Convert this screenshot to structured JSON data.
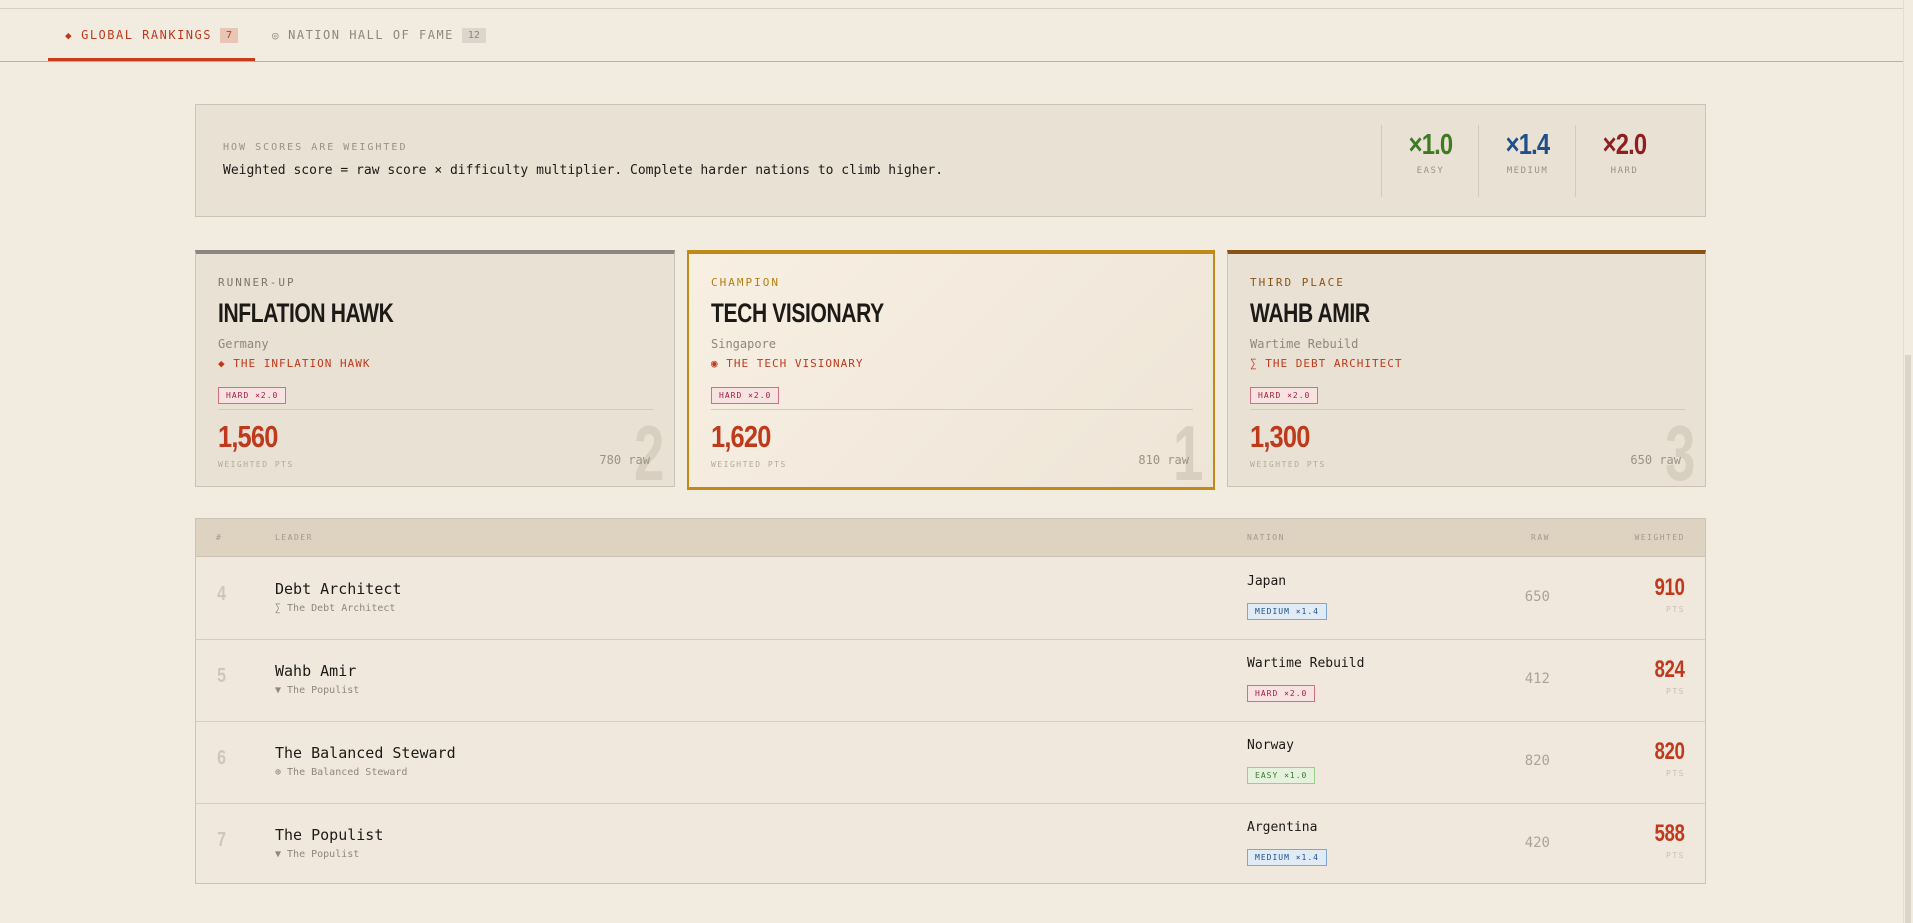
{
  "tabs": [
    {
      "glyph": "◆",
      "label": "GLOBAL RANKINGS",
      "count": "7"
    },
    {
      "glyph": "◎",
      "label": "NATION HALL OF FAME",
      "count": "12"
    }
  ],
  "weights": {
    "kicker": "HOW SCORES ARE WEIGHTED",
    "description": "Weighted score = raw score × difficulty multiplier. Complete harder nations to climb higher.",
    "multipliers": [
      {
        "value": "×1.0",
        "label": "EASY",
        "color": "#3f7a23"
      },
      {
        "value": "×1.4",
        "label": "MEDIUM",
        "color": "#1f4f8a"
      },
      {
        "value": "×2.0",
        "label": "HARD",
        "color": "#8f1e22"
      }
    ]
  },
  "podium": {
    "second": {
      "place": "RUNNER-UP",
      "name": "INFLATION HAWK",
      "nation": "Germany",
      "archetype_icon": "◆",
      "archetype": "THE INFLATION HAWK",
      "badge": "HARD ×2.0",
      "score": "1,560",
      "weighted_label": "WEIGHTED PTS",
      "raw": "780 raw",
      "rank": "2"
    },
    "first": {
      "place": "CHAMPION",
      "name": "TECH VISIONARY",
      "nation": "Singapore",
      "archetype_icon": "◉",
      "archetype": "THE TECH VISIONARY",
      "badge": "HARD ×2.0",
      "score": "1,620",
      "weighted_label": "WEIGHTED PTS",
      "raw": "810 raw",
      "rank": "1"
    },
    "third": {
      "place": "THIRD PLACE",
      "name": "WAHB AMIR",
      "nation": "Wartime Rebuild",
      "archetype_icon": "∑",
      "archetype": "THE DEBT ARCHITECT",
      "badge": "HARD ×2.0",
      "score": "1,300",
      "weighted_label": "WEIGHTED PTS",
      "raw": "650 raw",
      "rank": "3"
    }
  },
  "table": {
    "headers": {
      "rank": "#",
      "leader": "LEADER",
      "nation": "NATION",
      "raw": "RAW",
      "weighted": "WEIGHTED"
    },
    "rows": [
      {
        "rank": "4",
        "name": "Debt Architect",
        "archetype": "∑ The Debt Architect",
        "nation": "Japan",
        "badge": "MEDIUM ×1.4",
        "raw": "650",
        "weighted": "910",
        "pts": "PTS"
      },
      {
        "rank": "5",
        "name": "Wahb Amir",
        "archetype": "▼ The Populist",
        "nation": "Wartime Rebuild",
        "badge": "HARD ×2.0",
        "raw": "412",
        "weighted": "824",
        "pts": "PTS"
      },
      {
        "rank": "6",
        "name": "The Balanced Steward",
        "archetype": "⊕ The Balanced Steward",
        "nation": "Norway",
        "badge": "EASY ×1.0",
        "raw": "820",
        "weighted": "820",
        "pts": "PTS"
      },
      {
        "rank": "7",
        "name": "The Populist",
        "archetype": "▼ The Populist",
        "nation": "Argentina",
        "badge": "MEDIUM ×1.4",
        "raw": "420",
        "weighted": "588",
        "pts": "PTS"
      }
    ]
  }
}
